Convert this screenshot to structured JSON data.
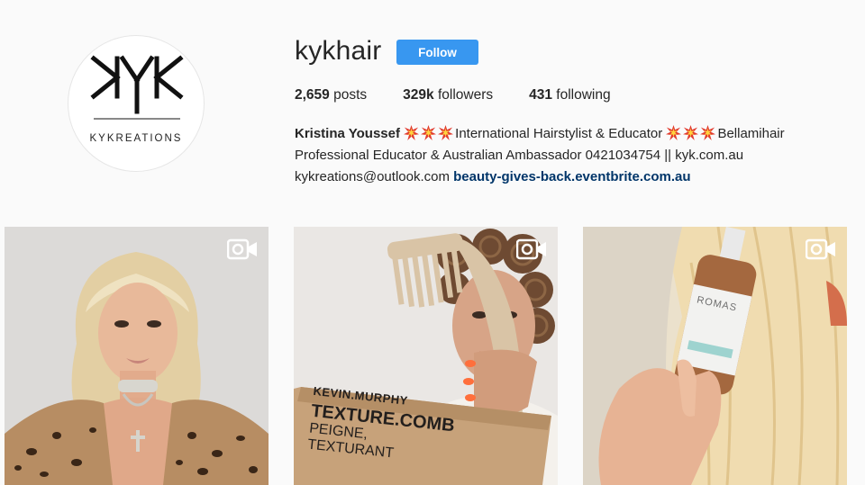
{
  "profile": {
    "username": "kykhair",
    "follow_label": "Follow",
    "avatar": {
      "logo_letters": "KYK",
      "caption": "KYKREATIONS"
    },
    "stats": {
      "posts_count": "2,659",
      "posts_label": " posts",
      "followers_count": "329k",
      "followers_label": " followers",
      "following_count": "431",
      "following_label": " following"
    },
    "bio": {
      "name": "Kristina Youssef",
      "emoji_name": "collision-emoji",
      "line1_mid": "International Hairstylist & Educator",
      "line1_tail": "Bellamihair",
      "line2": "Professional Educator & Australian Ambassador 0421034754 || kyk.com.au",
      "line3_email": "kykreations@outlook.com",
      "link": "beauty-gives-back.eventbrite.com.au"
    }
  },
  "posts": [
    {
      "type": "video",
      "icon": "video-camera-icon"
    },
    {
      "type": "video",
      "icon": "video-camera-icon",
      "package_brand": "KEVIN.MURPHY",
      "package_product": "TEXTURE.COMB",
      "package_sub1": "PEIGNE,",
      "package_sub2": "TEXTURANT"
    },
    {
      "type": "video",
      "icon": "video-camera-icon",
      "bottle_label": "ROMAS"
    }
  ],
  "colors": {
    "background": "#fafafa",
    "follow_button": "#3897f0",
    "link": "#003569",
    "text": "#262626"
  }
}
